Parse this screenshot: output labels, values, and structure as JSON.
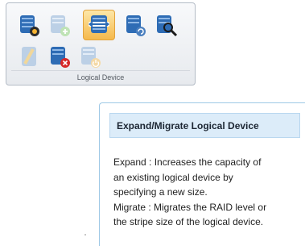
{
  "toolbar": {
    "group_label": "Logical Device",
    "buttons": [
      {
        "icon": "logical-device-properties-icon",
        "state": "enabled"
      },
      {
        "icon": "create-logical-device-icon",
        "state": "disabled"
      },
      {
        "icon": "expand-migrate-icon",
        "state": "selected"
      },
      {
        "icon": "logical-device-copy-icon",
        "state": "enabled"
      },
      {
        "icon": "logical-device-verify-icon",
        "state": "enabled"
      },
      {
        "icon": "erase-logical-device-icon",
        "state": "disabled"
      },
      {
        "icon": "delete-logical-device-icon",
        "state": "enabled"
      },
      {
        "icon": "logical-device-power-icon",
        "state": "disabled"
      }
    ]
  },
  "tooltip": {
    "title": "Expand/Migrate Logical Device",
    "lines": [
      "Expand : Increases the capacity of",
      "an existing logical device by",
      "specifying a new size.",
      "Migrate : Migrates the RAID level or",
      "the stripe size of the logical device."
    ]
  },
  "colors": {
    "accent": "#f5b94c",
    "database_icon": "#2e6cb5",
    "tooltip_title_bg": "#dcecf9"
  }
}
